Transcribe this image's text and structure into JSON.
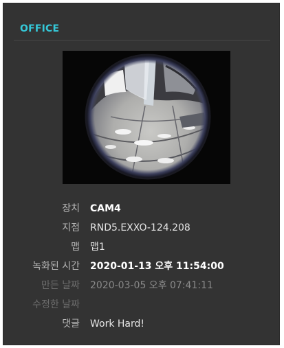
{
  "panel": {
    "title": "OFFICE",
    "title_color": "#35c8d8"
  },
  "camera": {
    "image_description_icon": "fisheye-camera-snapshot"
  },
  "info": {
    "device_label": "장치",
    "device_value": "CAM4",
    "site_label": "지점",
    "site_value": "RND5.EXXO-124.208",
    "map_label": "맵",
    "map_value": "맵1",
    "recorded_label": "녹화된 시간",
    "recorded_value": "2020-01-13 오후 11:54:00",
    "created_label": "만든 날짜",
    "created_value": "2020-03-05 오후 07:41:11",
    "modified_label": "수정한 날짜",
    "modified_value": "",
    "comment_label": "댓글",
    "comment_value": "Work Hard!"
  }
}
